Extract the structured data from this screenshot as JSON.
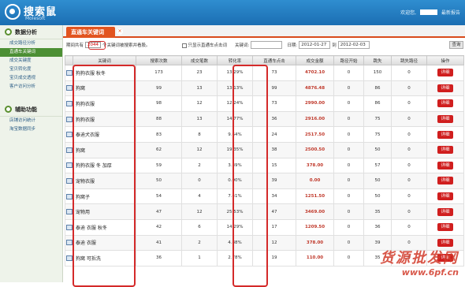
{
  "app": {
    "logo_text": "搜索鼠",
    "logo_sub": "Molesoft",
    "user_greeting": "欢迎您,",
    "logout": "最新报告"
  },
  "sidebar": {
    "section1": "数据分析",
    "items": [
      "成交路径分析",
      "直通车关键词",
      "成交关键度",
      "宝贝转化度",
      "宝贝成交透视",
      "客户访问分析"
    ],
    "active_index": 1,
    "section2": "辅助功能",
    "items2": [
      "店铺访问统计",
      "淘宝数据同步"
    ]
  },
  "tab": {
    "label": "直通车关键词",
    "close": "×"
  },
  "filter": {
    "prefix": "期间共有",
    "count": "2044",
    "suffix": "个关键词被搜索并看股。",
    "checkbox_label": "只显示直通车点击词",
    "keyword_label": "关键词:",
    "keyword_value": "",
    "date_label": "日期:",
    "date_from": "2012-01-27",
    "date_to_label": "到",
    "date_to": "2012-02-03",
    "query": "查询"
  },
  "table": {
    "headers": [
      "",
      "关键词",
      "搜索次数",
      "成交笔数",
      "转化率",
      "直通车点击",
      "成交金额",
      "路径开始",
      "跳失",
      "跳失路径",
      "操作"
    ],
    "rows": [
      {
        "kw": "狗狗衣服 秋冬",
        "search": "173",
        "deals": "23",
        "rate": "13.29%",
        "ztc": "73",
        "amount": "4702.10",
        "start": "0",
        "bounce": "150",
        "bpath": "0"
      },
      {
        "kw": "狗窝",
        "search": "99",
        "deals": "13",
        "rate": "13.13%",
        "ztc": "99",
        "amount": "4876.48",
        "start": "0",
        "bounce": "86",
        "bpath": "0"
      },
      {
        "kw": "狗狗衣服",
        "search": "98",
        "deals": "12",
        "rate": "12.24%",
        "ztc": "73",
        "amount": "2990.00",
        "start": "0",
        "bounce": "86",
        "bpath": "0"
      },
      {
        "kw": "狗狗衣服",
        "search": "88",
        "deals": "13",
        "rate": "14.77%",
        "ztc": "36",
        "amount": "2916.00",
        "start": "0",
        "bounce": "75",
        "bpath": "0"
      },
      {
        "kw": "泰迪犬衣服",
        "search": "83",
        "deals": "8",
        "rate": "9.64%",
        "ztc": "24",
        "amount": "2517.50",
        "start": "0",
        "bounce": "75",
        "bpath": "0"
      },
      {
        "kw": "狗窝",
        "search": "62",
        "deals": "12",
        "rate": "19.35%",
        "ztc": "38",
        "amount": "2500.50",
        "start": "0",
        "bounce": "50",
        "bpath": "0"
      },
      {
        "kw": "狗狗衣服 冬 加厚",
        "search": "59",
        "deals": "2",
        "rate": "3.39%",
        "ztc": "15",
        "amount": "378.00",
        "start": "0",
        "bounce": "57",
        "bpath": "0"
      },
      {
        "kw": "宠物衣服",
        "search": "50",
        "deals": "0",
        "rate": "0.00%",
        "ztc": "39",
        "amount": "0.00",
        "start": "0",
        "bounce": "50",
        "bpath": "0"
      },
      {
        "kw": "狗窝子",
        "search": "54",
        "deals": "4",
        "rate": "7.41%",
        "ztc": "34",
        "amount": "1251.50",
        "start": "0",
        "bounce": "50",
        "bpath": "0"
      },
      {
        "kw": "宠物用",
        "search": "47",
        "deals": "12",
        "rate": "25.53%",
        "ztc": "47",
        "amount": "3469.00",
        "start": "0",
        "bounce": "35",
        "bpath": "0"
      },
      {
        "kw": "泰迪 衣服 秋冬",
        "search": "42",
        "deals": "6",
        "rate": "14.29%",
        "ztc": "17",
        "amount": "1209.50",
        "start": "0",
        "bounce": "36",
        "bpath": "0"
      },
      {
        "kw": "泰迪 衣服",
        "search": "41",
        "deals": "2",
        "rate": "4.88%",
        "ztc": "12",
        "amount": "378.00",
        "start": "0",
        "bounce": "39",
        "bpath": "0"
      },
      {
        "kw": "狗窝 可拆洗",
        "search": "36",
        "deals": "1",
        "rate": "2.78%",
        "ztc": "19",
        "amount": "110.00",
        "start": "0",
        "bounce": "35",
        "bpath": "0"
      }
    ],
    "detail_label": "详细"
  },
  "watermark": {
    "line1": "货源批发网",
    "line2": "www.6pf.cn"
  },
  "colors": {
    "header": "#1b6eb2",
    "tab": "#e2541f",
    "highlight": "#d42a2a",
    "detail_button": "#d01e1e",
    "sidebar_active": "#4c8f34"
  }
}
